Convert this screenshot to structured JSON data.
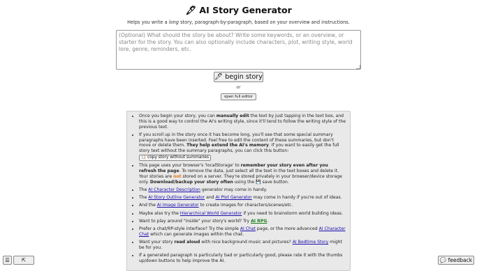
{
  "header": {
    "title": "🖋 AI Story Generator",
    "subtitle_before": "Helps you write a ",
    "subtitle_italic": "long",
    "subtitle_after": " story, paragraph-by-paragraph, based on your overview and instructions."
  },
  "prompt": {
    "placeholder": "(Optional) What should the story be about? Write some keywords, or an overview, or starter for the story. You can also optionally include characters, plot, writing style, world lore, genre, reminders, etc."
  },
  "controls": {
    "begin_label": "🖋 begin story",
    "or_label": "or",
    "full_editor_label": "open full editor"
  },
  "tips": {
    "t1_a": "Once you begin your story, you can ",
    "t1_b": "manually edit",
    "t1_c": " the text by just tapping in the text box, and this is a good way to control the AI's writing style, since it'll tend to follow the writing style of the previous text.",
    "t2_a": "If you scroll up in the story once it has become long, you'll see that some special summary paragraphs have been inserted. Feel free to edit the content of these summaries, but don't move or delete them. ",
    "t2_b": "They help extend the AI's memory",
    "t2_c": ". If you want to easily get the full story text without the summary paragraphs, you can click this button:",
    "copy_button": "📋 copy story without summaries",
    "t3_a": "This page uses your browser's 'localStorage' to ",
    "t3_b": "remember your story even after you refresh the page",
    "t3_c": ". To remove the data, just select all the text in the text boxes and delete it. Your stories are ",
    "t3_d": "not",
    "t3_e": " stored on a server. They're stored privately in your browser/device storage only. ",
    "t3_f": "Download/backup your story often",
    "t3_g": " using the 💾 save button.",
    "t4_a": "The ",
    "t4_link": "AI Character Description",
    "t4_b": " generator may come in handy.",
    "t5_a": "The ",
    "t5_link1": "AI Story Outline Generator",
    "t5_b": " and ",
    "t5_link2": "AI Plot Generator",
    "t5_c": " may come in handy if you're out of ideas.",
    "t6_a": "And the ",
    "t6_link": "AI Image Generator",
    "t6_b": " to create images for characters/scenes/etc.",
    "t7_a": "Maybe also try the ",
    "t7_link": "Hierarchical World Generator",
    "t7_b": " if you need to brainstorm world building ideas.",
    "t8_a": "Want to play around \"inside\" your story's world? Try ",
    "t8_link": "AI RPG",
    "t8_b": ".",
    "t9_a": "Prefer a chat/RP-style interface? Try the simple ",
    "t9_link1": "AI Chat",
    "t9_b": " page, or the more advanced ",
    "t9_link2": "AI Character Chat",
    "t9_c": " which can generate images within the chat.",
    "t10_a": "Want your story ",
    "t10_b": "read aloud",
    "t10_c": " with nice background music and pictures? ",
    "t10_link": "AI Bedtime Story",
    "t10_d": " might be for you.",
    "t11": "If a generated paragraph is particularly bad or particularly good, please rate it with the thumbs up/down buttons to help improve the AI."
  },
  "corner": {
    "menu_icon": "☰",
    "expand_icon": "⇱",
    "feedback_label": "💬 feedback"
  }
}
